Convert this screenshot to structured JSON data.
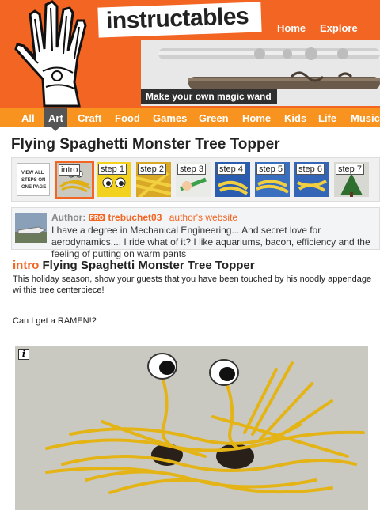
{
  "logo": {
    "text": "instructables"
  },
  "topnav": {
    "home": "Home",
    "explore": "Explore"
  },
  "banner": {
    "caption": "Make your own magic wand"
  },
  "categories": [
    "All",
    "Art",
    "Craft",
    "Food",
    "Games",
    "Green",
    "Home",
    "Kids",
    "Life",
    "Music"
  ],
  "active_category": "Art",
  "title": "Flying Spaghetti Monster Tree Topper",
  "steps": {
    "all_label": "VIEW ALL STEPS ON ONE PAGE",
    "items": [
      "intro",
      "step 1",
      "step 2",
      "step 3",
      "step 4",
      "step 5",
      "step 6",
      "step 7"
    ]
  },
  "author": {
    "label": "Author:",
    "pro_badge": "PRO",
    "name": "trebuchet03",
    "site": "author's website",
    "bio": "I have a degree in Mechanical Engineering... And secret love for aerodynamics.... I ride what of it? I like aquariums, bacon, efficiency and the feeling of putting on warm pants"
  },
  "intro": {
    "tag": "intro",
    "title": "Flying Spaghetti Monster Tree Topper",
    "text": "This holiday season, show your guests that you have been touched by his noodly appendage wi this tree centerpiece!",
    "ramen": "Can I get a RAMEN!?"
  },
  "photo": {
    "info_icon": "i"
  },
  "colors": {
    "brand_orange": "#f26522",
    "nav_orange": "#f7931e",
    "active_tab": "#555555"
  }
}
